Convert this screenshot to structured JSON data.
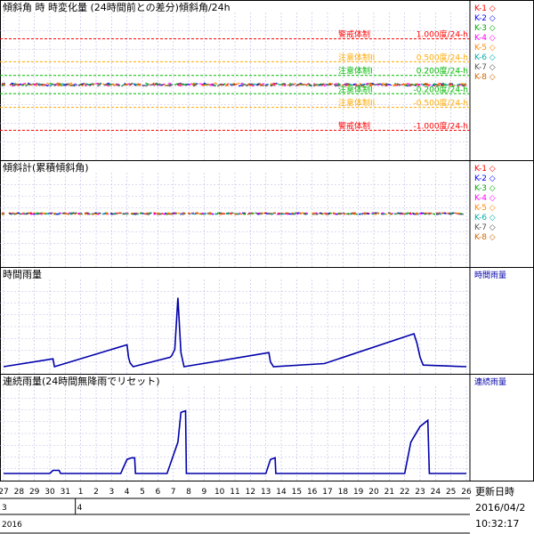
{
  "panels": [
    {
      "id": "tilt-change",
      "title": "傾斜角 時 時変化量 (24時間前との差分)傾斜角/24h",
      "legend": [
        {
          "label": "K-1",
          "suffix": "◇",
          "color": "#ff0000"
        },
        {
          "label": "K-2",
          "suffix": "◇",
          "color": "#0000ff"
        },
        {
          "label": "K-3",
          "suffix": "◇",
          "color": "#00aa00"
        },
        {
          "label": "K-4",
          "suffix": "◇",
          "color": "#ff00ff"
        },
        {
          "label": "K-5",
          "suffix": "◇",
          "color": "#ff8800"
        },
        {
          "label": "K-6",
          "suffix": "◇",
          "color": "#00aaaa"
        },
        {
          "label": "K-7",
          "suffix": "◇",
          "color": "#555555"
        },
        {
          "label": "K-8",
          "suffix": "◇",
          "color": "#cc6600"
        }
      ],
      "thresholds": [
        {
          "name": "警戒体制",
          "value_text": "1.000度/24-h",
          "value": 1.0,
          "color": "#ff0000"
        },
        {
          "name": "注意体制II",
          "value_text": "0.500度/24-h",
          "value": 0.5,
          "color": "#ffaa00"
        },
        {
          "name": "注意体制I",
          "value_text": "0.200度/24-h",
          "value": 0.2,
          "color": "#00bb00"
        },
        {
          "name": "注意体制I",
          "value_text": "-0.200度/24-h",
          "value": -0.2,
          "color": "#00bb00"
        },
        {
          "name": "注意体制II",
          "value_text": "-0.500度/24-h",
          "value": -0.5,
          "color": "#ffaa00"
        },
        {
          "name": "警戒体制",
          "value_text": "-1.000度/24-h",
          "value": -1.0,
          "color": "#ff0000"
        }
      ]
    },
    {
      "id": "tilt-cumulative",
      "title": "傾斜計(累積傾斜角)",
      "legend": [
        {
          "label": "K-1",
          "suffix": "◇",
          "color": "#ff0000"
        },
        {
          "label": "K-2",
          "suffix": "◇",
          "color": "#0000ff"
        },
        {
          "label": "K-3",
          "suffix": "◇",
          "color": "#00aa00"
        },
        {
          "label": "K-4",
          "suffix": "◇",
          "color": "#ff00ff"
        },
        {
          "label": "K-5",
          "suffix": "◇",
          "color": "#ff8800"
        },
        {
          "label": "K-6",
          "suffix": "◇",
          "color": "#00aaaa"
        },
        {
          "label": "K-7",
          "suffix": "◇",
          "color": "#555555"
        },
        {
          "label": "K-8",
          "suffix": "◇",
          "color": "#cc6600"
        }
      ]
    },
    {
      "id": "hourly-rain",
      "title": "時間雨量",
      "legend": [
        {
          "label": "時間雨量",
          "suffix": "",
          "color": "#0000aa"
        }
      ]
    },
    {
      "id": "continuous-rain",
      "title": "連続雨量(24時間無降雨でリセット)",
      "legend": [
        {
          "label": "連続雨量",
          "suffix": "",
          "color": "#0000aa"
        }
      ]
    }
  ],
  "footer": {
    "update_label": "更新日時",
    "update_date": "2016/04/2",
    "update_time": "10:32:17",
    "month_row": [
      "3",
      "4"
    ],
    "year_row": "2016"
  },
  "chart_data": [
    {
      "type": "line",
      "title": "傾斜角 時 時変化量 (24時間前との差分)傾斜角/24h",
      "x_ticks": [
        "27",
        "28",
        "29",
        "30",
        "31",
        "1",
        "2",
        "3",
        "4",
        "5",
        "6",
        "7",
        "8",
        "9",
        "10",
        "11",
        "12",
        "13",
        "14",
        "15",
        "16",
        "17",
        "18",
        "19",
        "20",
        "21",
        "22",
        "23",
        "24",
        "25",
        "26"
      ],
      "ylim": [
        -1.5,
        1.5
      ],
      "series_count": 8,
      "approx_value": 0.0
    },
    {
      "type": "line",
      "title": "傾斜計(累積傾斜角)",
      "x_ticks": [
        "27",
        "28",
        "29",
        "30",
        "31",
        "1",
        "2",
        "3",
        "4",
        "5",
        "6",
        "7",
        "8",
        "9",
        "10",
        "11",
        "12",
        "13",
        "14",
        "15",
        "16",
        "17",
        "18",
        "19",
        "20",
        "21",
        "22",
        "23",
        "24",
        "25",
        "26"
      ],
      "series_count": 8,
      "approx_value": 0.0
    },
    {
      "type": "line",
      "title": "時間雨量",
      "x_ticks": [
        "27",
        "28",
        "29",
        "30",
        "31",
        "1",
        "2",
        "3",
        "4",
        "5",
        "6",
        "7",
        "8",
        "9",
        "10",
        "11",
        "12",
        "13",
        "14",
        "15",
        "16",
        "17",
        "18",
        "19",
        "20",
        "21",
        "22",
        "23",
        "24",
        "25",
        "26"
      ],
      "ylim": [
        0,
        100
      ],
      "x": [
        3.2,
        3.3,
        8.0,
        8.1,
        8.2,
        8.4,
        10.8,
        10.9,
        11.1,
        11.3,
        11.5,
        11.7,
        17.2,
        17.3,
        17.5,
        20.8,
        26.6,
        26.8,
        27.0,
        27.2
      ],
      "values": [
        10,
        0,
        28,
        12,
        5,
        0,
        12,
        14,
        22,
        88,
        18,
        0,
        18,
        6,
        0,
        4,
        42,
        30,
        12,
        2
      ]
    },
    {
      "type": "line",
      "title": "連続雨量(24時間無降雨でリセット)",
      "x_ticks": [
        "27",
        "28",
        "29",
        "30",
        "31",
        "1",
        "2",
        "3",
        "4",
        "5",
        "6",
        "7",
        "8",
        "9",
        "10",
        "11",
        "12",
        "13",
        "14",
        "15",
        "16",
        "17",
        "18",
        "19",
        "20",
        "21",
        "22",
        "23",
        "24",
        "25",
        "26"
      ],
      "ylim": [
        0,
        100
      ],
      "x": [
        3.0,
        3.2,
        3.6,
        3.7,
        7.6,
        8.0,
        8.3,
        8.5,
        8.55,
        10.6,
        11.3,
        11.5,
        11.8,
        11.85,
        17.0,
        17.3,
        17.6,
        17.65,
        26.0,
        26.4,
        27.0,
        27.5,
        27.6
      ],
      "values": [
        0,
        4,
        4,
        0,
        0,
        18,
        20,
        20,
        0,
        0,
        40,
        78,
        80,
        0,
        0,
        18,
        20,
        0,
        0,
        40,
        60,
        68,
        0
      ]
    }
  ]
}
